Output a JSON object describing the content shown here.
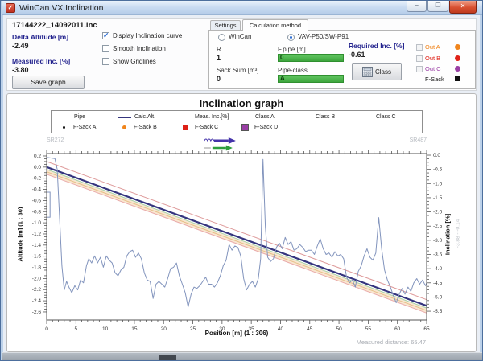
{
  "window": {
    "title": "WinCan VX Inclination",
    "minimize": "–",
    "maximize": "❐",
    "close": "✕"
  },
  "file_panel": {
    "filename": "17144222_14092011.inc",
    "delta_altitude_label": "Delta Altitude [m]",
    "delta_altitude_value": "-2.49",
    "measured_inc_label": "Measured Inc. [%]",
    "measured_inc_value": "-3.80",
    "checkbox_display": "Display Inclination curve",
    "checkbox_smooth": "Smooth Inclination",
    "checkbox_gridlines": "Show Gridlines",
    "save_button": "Save graph"
  },
  "tabs": {
    "settings": "Settings",
    "calculation": "Calculation method"
  },
  "calc": {
    "radio_wincan": "WinCan",
    "radio_vav": "VAV-P50/SW-P91",
    "r_label": "R",
    "r_value": "1",
    "fpipe_label": "F.pipe [m]",
    "fpipe_value": "0",
    "sack_label": "Sack Sum [m³]",
    "sack_value": "0",
    "pipeclass_label": "Pipe-class",
    "pipeclass_value": "A",
    "required_label": "Required Inc. [%]",
    "required_value": "-0.61",
    "class_button": "Class",
    "out_a_label": "Out A",
    "out_b_label": "Out B",
    "out_c_label": "Out C",
    "fsack_label": "F-Sack",
    "out_a_color": "#f0851c",
    "out_b_color": "#e02218",
    "out_c_color": "#9a3fa5",
    "fsack_color": "#111111"
  },
  "chart_data": {
    "type": "line",
    "title": "Inclination graph",
    "start_node": "SR272",
    "end_node": "SR487",
    "measured_distance_text": "Measured distance: 65.47",
    "xlabel": "Position [m] (1 : 306)",
    "axes": {
      "x": {
        "min": 0,
        "max": 65,
        "major_step": 5,
        "minor_step": 1
      },
      "left": {
        "label": "Altitude [m] (1 : 30)",
        "top": 0.243,
        "bottom": -2.745,
        "tick_max": 0.2,
        "tick_min": -2.6,
        "major_step": 0.2,
        "minor_step": 0.05
      },
      "right": {
        "label": "Inclination [%]",
        "sub_label": "-3.88 - -0.14",
        "top": 0.057,
        "bottom": -5.81,
        "tick_max": 0.0,
        "tick_min": -5.5,
        "major_step": 0.5,
        "minor_step": 0.125
      }
    },
    "legend": {
      "row1": [
        {
          "label": "Pipe",
          "color": "#de9a9a",
          "type": "line"
        },
        {
          "label": "Calc.Alt.",
          "color": "#35357e",
          "type": "line-thick"
        },
        {
          "label": "Meas. Inc.[%]",
          "color": "#8294bd",
          "type": "line"
        },
        {
          "label": "Class A",
          "color": "#a8d2a8",
          "type": "line"
        },
        {
          "label": "Class B",
          "color": "#e6c08a",
          "type": "line"
        },
        {
          "label": "Class C",
          "color": "#e9aaaa",
          "type": "line"
        }
      ],
      "row2": [
        {
          "label": "F-Sack A",
          "color": "#111111",
          "type": "dot-small"
        },
        {
          "label": "F-Sack B",
          "color": "#f0851c",
          "type": "dot"
        },
        {
          "label": "F-Sack C",
          "color": "#dd2016",
          "type": "square"
        },
        {
          "label": "F-Sack D",
          "color": "#9a3fa5",
          "type": "square-big"
        }
      ]
    },
    "band": {
      "top_start": -0.04,
      "top_end": -2.53,
      "bottom_start": -0.13,
      "bottom_end": -2.62,
      "color": "#f0c08a",
      "opacity": 0.4
    },
    "start_marker": {
      "x": 0.3,
      "alt_top": -0.45,
      "alt_bottom": -0.9
    },
    "direction_arrows": {
      "x": 30,
      "blue": "#4433aa",
      "green": "#2e9e3e"
    },
    "series": [
      {
        "name": "Pipe",
        "axis": "left",
        "color": "#de9a9a",
        "width": 1,
        "points": [
          [
            0,
            0.1
          ],
          [
            65,
            -2.38
          ]
        ]
      },
      {
        "name": "Class A",
        "axis": "left",
        "color": "#a8d2a8",
        "width": 1,
        "points": [
          [
            0,
            -0.04
          ],
          [
            65,
            -2.53
          ]
        ]
      },
      {
        "name": "Class B",
        "axis": "left",
        "color": "#e6c08a",
        "width": 1,
        "points": [
          [
            0,
            -0.085
          ],
          [
            65,
            -2.575
          ]
        ]
      },
      {
        "name": "Class C",
        "axis": "left",
        "color": "#e9aaaa",
        "width": 1,
        "points": [
          [
            0,
            -0.13
          ],
          [
            65,
            -2.62
          ]
        ]
      },
      {
        "name": "Calc.Alt.",
        "axis": "left",
        "color": "#35357e",
        "width": 2.2,
        "points": [
          [
            0,
            0.0
          ],
          [
            65,
            -2.49
          ]
        ]
      },
      {
        "name": "Meas. Inc.[%]",
        "axis": "right",
        "color": "#8294bd",
        "width": 1,
        "points": [
          [
            0,
            -0.08
          ],
          [
            0.7,
            -0.1
          ],
          [
            1.4,
            -0.12
          ],
          [
            1.8,
            -0.5
          ],
          [
            2.2,
            -2.2
          ],
          [
            2.6,
            -3.9
          ],
          [
            3,
            -4.75
          ],
          [
            3.4,
            -4.45
          ],
          [
            3.8,
            -4.65
          ],
          [
            4.3,
            -4.85
          ],
          [
            4.8,
            -4.6
          ],
          [
            5.3,
            -4.75
          ],
          [
            5.8,
            -4.4
          ],
          [
            6.3,
            -4.5
          ],
          [
            6.8,
            -3.9
          ],
          [
            7.2,
            -3.65
          ],
          [
            7.7,
            -3.8
          ],
          [
            8.2,
            -3.55
          ],
          [
            8.7,
            -3.8
          ],
          [
            9.2,
            -3.6
          ],
          [
            9.7,
            -3.95
          ],
          [
            10.2,
            -3.55
          ],
          [
            10.7,
            -3.7
          ],
          [
            11.2,
            -3.8
          ],
          [
            11.7,
            -4.15
          ],
          [
            12.2,
            -4.25
          ],
          [
            12.7,
            -4.05
          ],
          [
            13.2,
            -3.95
          ],
          [
            13.7,
            -3.55
          ],
          [
            14.2,
            -3.4
          ],
          [
            14.7,
            -3.35
          ],
          [
            15.2,
            -3.6
          ],
          [
            15.7,
            -3.45
          ],
          [
            16.2,
            -3.65
          ],
          [
            16.7,
            -4.15
          ],
          [
            17.2,
            -4.4
          ],
          [
            17.7,
            -4.45
          ],
          [
            18.2,
            -5.05
          ],
          [
            18.7,
            -4.55
          ],
          [
            19.2,
            -4.45
          ],
          [
            19.7,
            -4.55
          ],
          [
            20.2,
            -4.65
          ],
          [
            20.7,
            -4.35
          ],
          [
            21.2,
            -4
          ],
          [
            21.7,
            -3.95
          ],
          [
            22.2,
            -3.8
          ],
          [
            22.7,
            -4.25
          ],
          [
            23.2,
            -4.55
          ],
          [
            23.7,
            -4.85
          ],
          [
            24.2,
            -5.35
          ],
          [
            24.7,
            -4.9
          ],
          [
            25.2,
            -4.65
          ],
          [
            25.7,
            -4.7
          ],
          [
            26.2,
            -4.6
          ],
          [
            26.7,
            -4.45
          ],
          [
            27.2,
            -4.3
          ],
          [
            27.7,
            -4.55
          ],
          [
            28.2,
            -4.55
          ],
          [
            28.7,
            -4.65
          ],
          [
            29.2,
            -4.5
          ],
          [
            29.7,
            -4.25
          ],
          [
            30.2,
            -3.9
          ],
          [
            30.7,
            -3.7
          ],
          [
            31.2,
            -3.15
          ],
          [
            31.7,
            -3.35
          ],
          [
            32.2,
            -3.2
          ],
          [
            32.7,
            -3.25
          ],
          [
            33.2,
            -3.55
          ],
          [
            33.7,
            -4.35
          ],
          [
            34.2,
            -4.75
          ],
          [
            34.7,
            -4.55
          ],
          [
            35.2,
            -4.45
          ],
          [
            35.7,
            -4.65
          ],
          [
            36.2,
            -4.35
          ],
          [
            36.6,
            -3.65
          ],
          [
            37,
            -0.15
          ],
          [
            37.4,
            -2.5
          ],
          [
            37.8,
            -3.6
          ],
          [
            38.3,
            -3.75
          ],
          [
            38.8,
            -3.65
          ],
          [
            39.3,
            -3.25
          ],
          [
            39.8,
            -3.1
          ],
          [
            40.3,
            -3.3
          ],
          [
            40.8,
            -2.9
          ],
          [
            41.3,
            -3.15
          ],
          [
            41.8,
            -3.05
          ],
          [
            42.3,
            -3.35
          ],
          [
            42.8,
            -3.3
          ],
          [
            43.3,
            -3.15
          ],
          [
            43.8,
            -3.25
          ],
          [
            44.3,
            -3.4
          ],
          [
            44.8,
            -3.35
          ],
          [
            45.3,
            -3.35
          ],
          [
            45.8,
            -3.5
          ],
          [
            46.3,
            -3.2
          ],
          [
            46.8,
            -2.95
          ],
          [
            47.3,
            -3.3
          ],
          [
            47.8,
            -3.5
          ],
          [
            48.3,
            -3.45
          ],
          [
            48.8,
            -3.6
          ],
          [
            49.3,
            -3.4
          ],
          [
            49.8,
            -3.55
          ],
          [
            50.3,
            -3.5
          ],
          [
            50.8,
            -3.65
          ],
          [
            51.3,
            -4.3
          ],
          [
            51.8,
            -4.5
          ],
          [
            52.3,
            -4.4
          ],
          [
            52.8,
            -4.65
          ],
          [
            53.3,
            -4.1
          ],
          [
            53.8,
            -3.9
          ],
          [
            54.3,
            -3.55
          ],
          [
            54.8,
            -3.3
          ],
          [
            55.3,
            -3.6
          ],
          [
            55.8,
            -3.7
          ],
          [
            56.3,
            -3.45
          ],
          [
            56.8,
            -2.2
          ],
          [
            57.3,
            -3.3
          ],
          [
            57.8,
            -4.05
          ],
          [
            58.3,
            -4.4
          ],
          [
            58.8,
            -4.65
          ],
          [
            59.3,
            -4.95
          ],
          [
            59.8,
            -5.2
          ],
          [
            60.3,
            -4.9
          ],
          [
            60.8,
            -4.7
          ],
          [
            61.3,
            -4.9
          ],
          [
            61.8,
            -4.65
          ],
          [
            62.3,
            -4.8
          ],
          [
            62.8,
            -4.5
          ],
          [
            63.3,
            -4.35
          ],
          [
            63.8,
            -4.55
          ],
          [
            64.3,
            -4.4
          ],
          [
            64.8,
            -4.6
          ],
          [
            65,
            -4.5
          ]
        ]
      }
    ]
  }
}
